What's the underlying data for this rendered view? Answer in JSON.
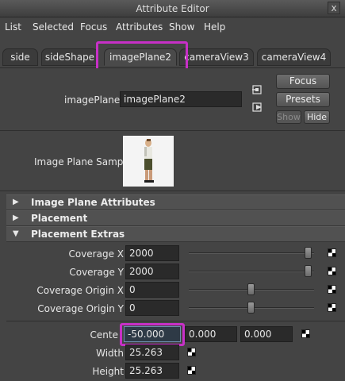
{
  "window": {
    "title": "Attribute Editor",
    "close_glyph": "x"
  },
  "menu": [
    "List",
    "Selected",
    "Focus",
    "Attributes",
    "Show",
    "Help"
  ],
  "tabs": [
    "side",
    "sideShape",
    "imagePlane2",
    "cameraView3",
    "cameraView4"
  ],
  "active_tab": "imagePlane2",
  "node": {
    "label": "imagePlane:",
    "value": "imagePlane2"
  },
  "buttons": {
    "focus": "Focus",
    "presets": "Presets",
    "show": "Show",
    "hide": "Hide"
  },
  "sample": {
    "label": "Image Plane Sample"
  },
  "sections": [
    {
      "label": "Image Plane Attributes",
      "expanded": false
    },
    {
      "label": "Placement",
      "expanded": false
    },
    {
      "label": "Placement Extras",
      "expanded": true
    }
  ],
  "attributes": [
    {
      "label": "Coverage X",
      "value": "2000",
      "slider_fraction": 0.95
    },
    {
      "label": "Coverage Y",
      "value": "2000",
      "slider_fraction": 0.95
    },
    {
      "label": "Coverage Origin X",
      "value": "0",
      "slider_fraction": 0.5
    },
    {
      "label": "Coverage Origin Y",
      "value": "0",
      "slider_fraction": 0.5
    }
  ],
  "center": {
    "label": "Cente",
    "values": [
      "-50.000",
      "0.000",
      "0.000"
    ]
  },
  "width": {
    "label": "Width",
    "value": "25.263"
  },
  "height": {
    "label": "Height",
    "value": "25.263"
  },
  "colors": {
    "highlight": "#c730c7",
    "panel": "#444444",
    "field": "#2a2a2a"
  },
  "icons": [
    "close-icon",
    "input-connection-icon",
    "output-connection-icon",
    "expand-arrow-icon",
    "collapse-arrow-icon",
    "map-checker-icon"
  ]
}
